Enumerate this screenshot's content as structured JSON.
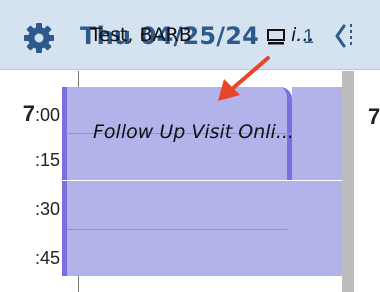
{
  "header": {
    "title": "Thu 04/25/24",
    "count": "1"
  },
  "time_slots": [
    {
      "hour": "7",
      "minute": ":00"
    },
    {
      "minute": ":15"
    },
    {
      "minute": ":30"
    },
    {
      "minute": ":45"
    }
  ],
  "appointments": [
    {
      "name": "Test, BARB",
      "overflow": "i..."
    },
    {
      "title": "Follow Up Visit Onli..."
    }
  ],
  "next_column_hour": "7",
  "colors": {
    "header_bg": "#d5e3f0",
    "accent": "#2d5a8a",
    "appointment_fill": "#b3b3ec",
    "appointment_border": "#7b6fe0",
    "annotation_arrow": "#e8462a"
  }
}
